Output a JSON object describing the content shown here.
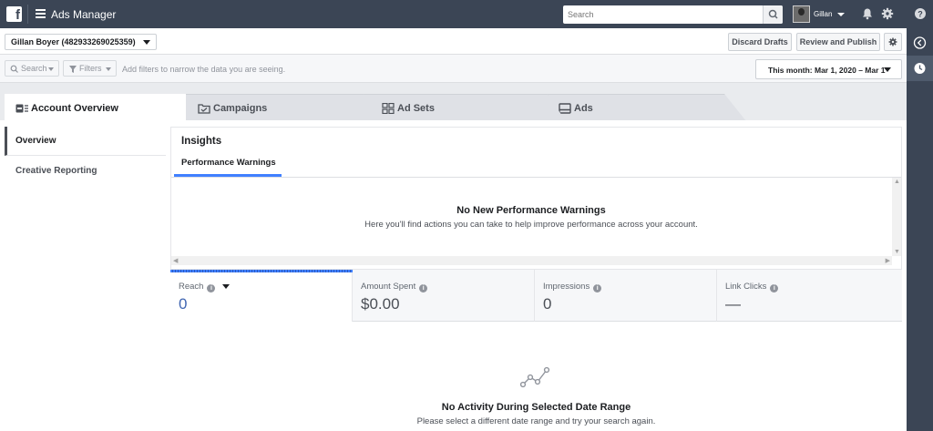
{
  "topbar": {
    "app_title": "Ads Manager",
    "search_placeholder": "Search",
    "user_name": "Gillan"
  },
  "accountbar": {
    "account_label": "Gillan Boyer (482933269025359)",
    "discard_label": "Discard Drafts",
    "review_label": "Review and Publish"
  },
  "filterbar": {
    "search_label": "Search",
    "filters_label": "Filters",
    "hint": "Add filters to narrow the data you are seeing.",
    "date_range": "This month: Mar 1, 2020 – Mar 1"
  },
  "tabs": [
    {
      "label": "Account Overview"
    },
    {
      "label": "Campaigns"
    },
    {
      "label": "Ad Sets"
    },
    {
      "label": "Ads"
    }
  ],
  "left_nav": [
    {
      "label": "Overview"
    },
    {
      "label": "Creative Reporting"
    }
  ],
  "insights": {
    "title": "Insights",
    "tab": "Performance Warnings",
    "empty_title": "No New Performance Warnings",
    "empty_sub": "Here you'll find actions you can take to help improve performance across your account."
  },
  "metrics": [
    {
      "label": "Reach",
      "value": "0"
    },
    {
      "label": "Amount Spent",
      "value": "$0.00"
    },
    {
      "label": "Impressions",
      "value": "0"
    },
    {
      "label": "Link Clicks",
      "value": "—"
    }
  ],
  "activity": {
    "title": "No Activity During Selected Date Range",
    "sub": "Please select a different date range and try your search again."
  },
  "colors": {
    "topbar": "#3b4555",
    "accent": "#4080ff",
    "metric_active_value": "#4267b2"
  }
}
